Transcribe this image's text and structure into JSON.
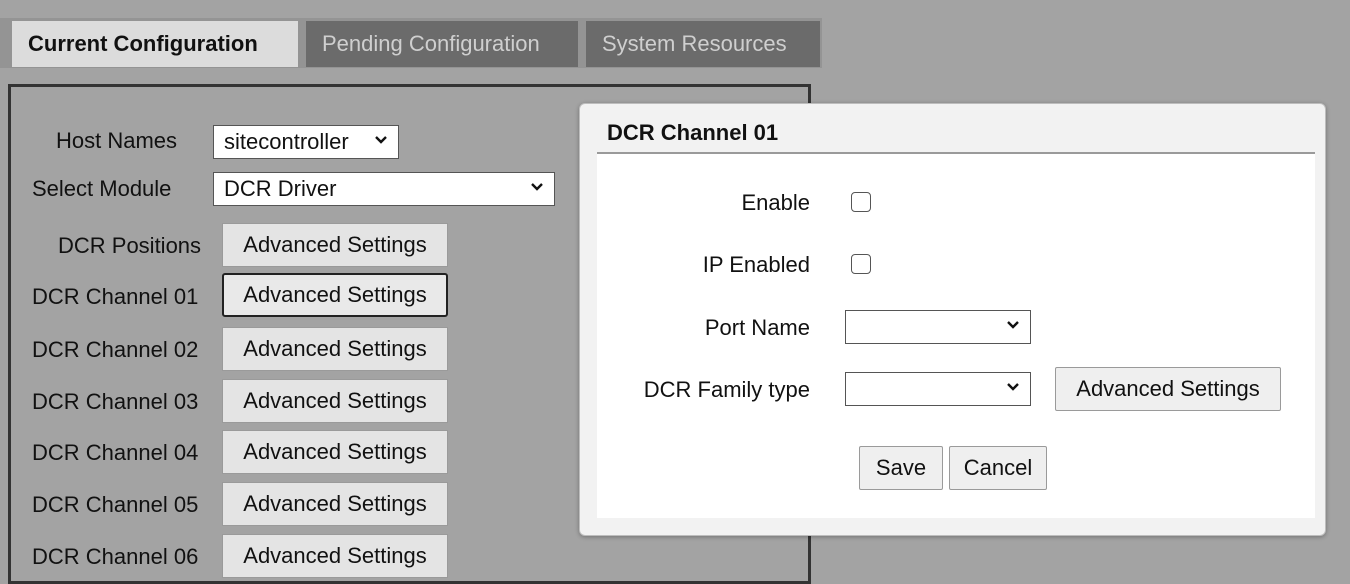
{
  "tabs": [
    {
      "label": "Current Configuration",
      "active": true
    },
    {
      "label": "Pending Configuration",
      "active": false
    },
    {
      "label": "System Resources",
      "active": false
    }
  ],
  "config": {
    "host_label": "Host Names",
    "host_value": "sitecontroller",
    "module_label": "Select Module",
    "module_value": "DCR Driver",
    "rows": [
      {
        "label": "DCR Positions",
        "button": "Advanced Settings"
      },
      {
        "label": "DCR Channel 01",
        "button": "Advanced Settings"
      },
      {
        "label": "DCR Channel 02",
        "button": "Advanced Settings"
      },
      {
        "label": "DCR Channel 03",
        "button": "Advanced Settings"
      },
      {
        "label": "DCR Channel 04",
        "button": "Advanced Settings"
      },
      {
        "label": "DCR Channel 05",
        "button": "Advanced Settings"
      },
      {
        "label": "DCR Channel 06",
        "button": "Advanced Settings"
      }
    ]
  },
  "dialog": {
    "title": "DCR Channel 01",
    "enable_label": "Enable",
    "enable_checked": false,
    "ip_label": "IP Enabled",
    "ip_checked": false,
    "port_label": "Port Name",
    "port_value": "",
    "family_label": "DCR Family type",
    "family_value": "",
    "advanced_button": "Advanced Settings",
    "save_button": "Save",
    "cancel_button": "Cancel"
  },
  "colors": {
    "background": "#a3a3a3",
    "active_tab": "#dcdcdc",
    "inactive_tab": "#6b6b6b"
  }
}
